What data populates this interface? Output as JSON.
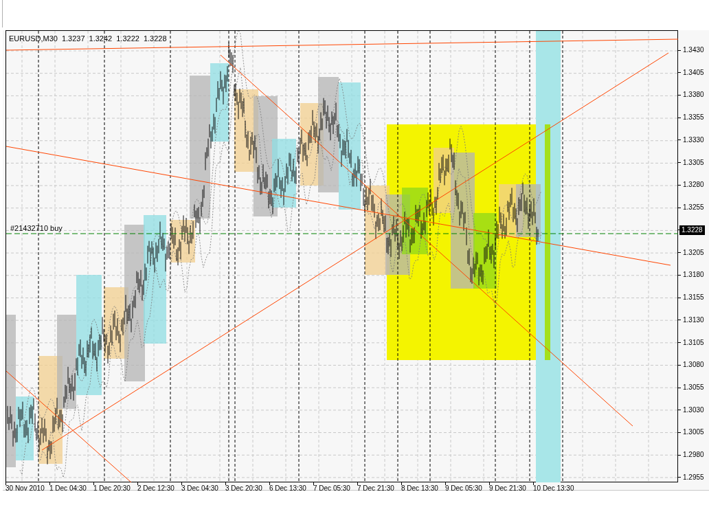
{
  "chart_header": {
    "symbol": "EURUSD,M30",
    "quotes": [
      "1.3237",
      "1.3242",
      "1.3222",
      "1.3228"
    ]
  },
  "order_label": "#21432710 buy",
  "price_axis": [
    {
      "kind": "tick",
      "label": "1.3430"
    },
    {
      "kind": "tick",
      "label": "1.3405"
    },
    {
      "kind": "tick",
      "label": "1.3380"
    },
    {
      "kind": "tick",
      "label": "1.3355"
    },
    {
      "kind": "tick",
      "label": "1.3330"
    },
    {
      "kind": "tick",
      "label": "1.3305"
    },
    {
      "kind": "tick",
      "label": "1.3280"
    },
    {
      "kind": "tick",
      "label": "1.3255"
    },
    {
      "kind": "current_price",
      "label": "1.3228"
    },
    {
      "kind": "tick",
      "label": "1.3205"
    },
    {
      "kind": "tick",
      "label": "1.3180"
    },
    {
      "kind": "tick",
      "label": "1.3155"
    },
    {
      "kind": "tick",
      "label": "1.3130"
    },
    {
      "kind": "tick",
      "label": "1.3105"
    },
    {
      "kind": "tick",
      "label": "1.3080"
    },
    {
      "kind": "tick",
      "label": "1.3055"
    },
    {
      "kind": "tick",
      "label": "1.3030"
    },
    {
      "kind": "tick",
      "label": "1.3005"
    },
    {
      "kind": "tick",
      "label": "1.2980"
    },
    {
      "kind": "tick",
      "label": "1.2955"
    }
  ],
  "time_axis": [
    "30 Nov 2010",
    "1 Dec 04:30",
    "1 Dec 20:30",
    "2 Dec 12:30",
    "3 Dec 04:30",
    "3 Dec 20:30",
    "6 Dec 13:30",
    "7 Dec 05:30",
    "7 Dec 21:30",
    "8 Dec 13:30",
    "9 Dec 05:30",
    "9 Dec 21:30",
    "10 Dec 13:30"
  ]
}
